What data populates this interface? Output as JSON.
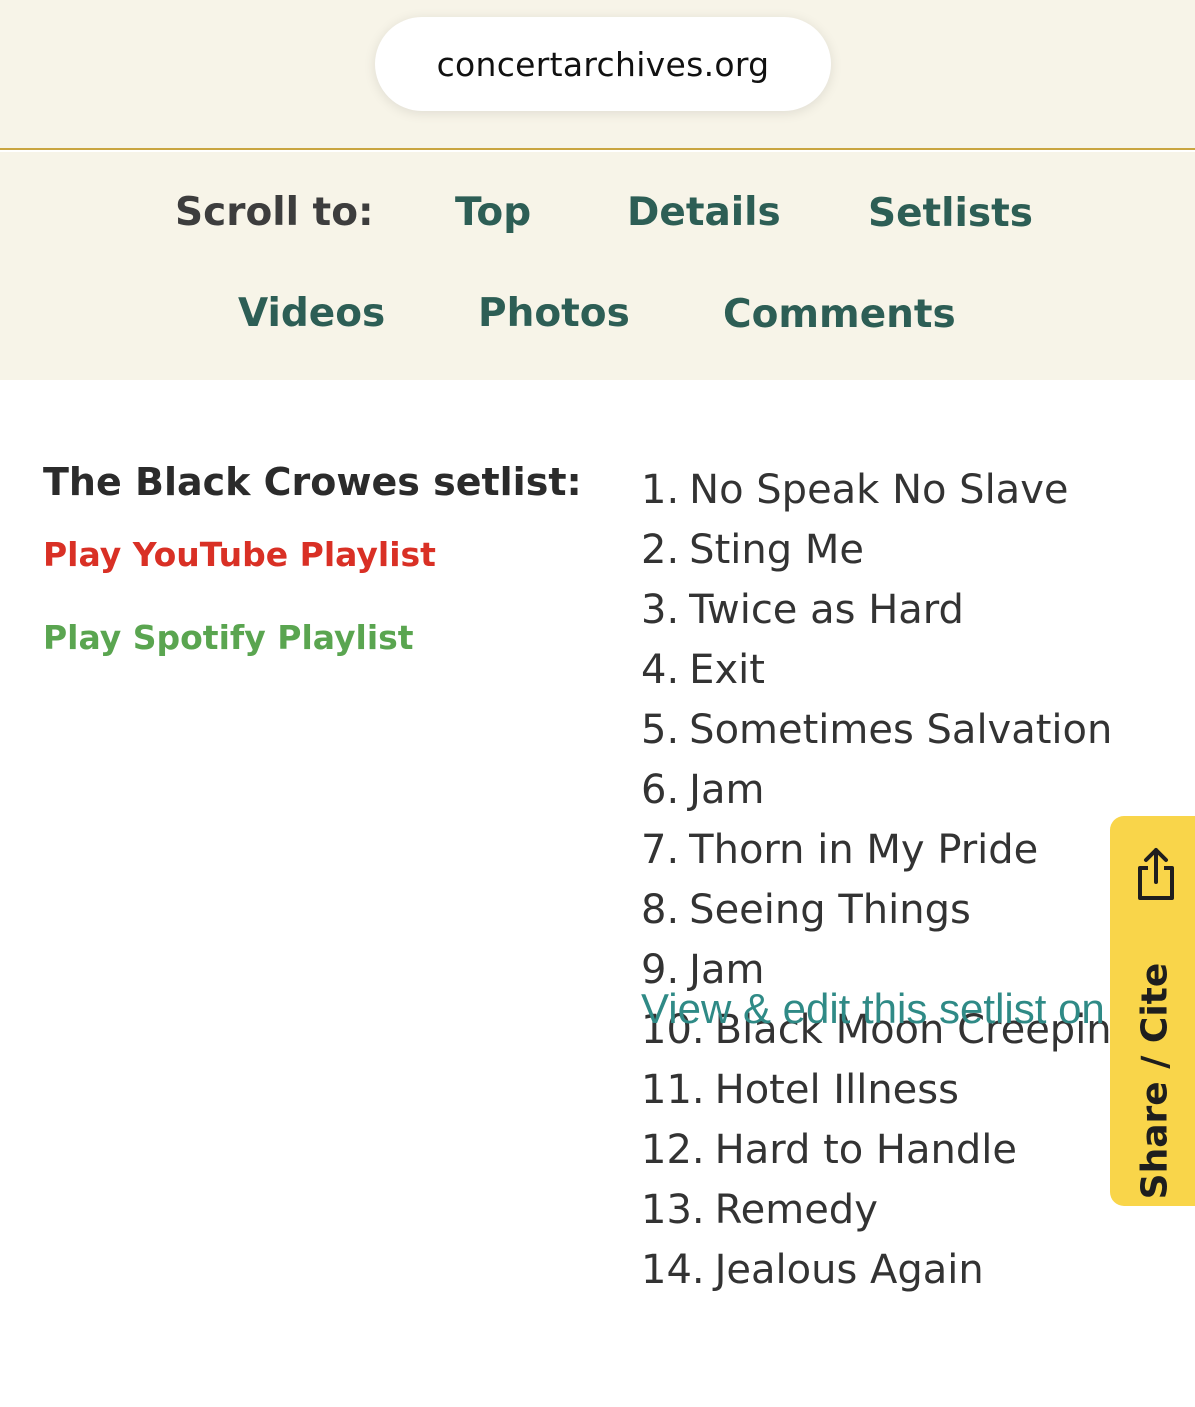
{
  "browser": {
    "url": "concertarchives.org"
  },
  "scroll_nav": {
    "label": "Scroll to:",
    "items": [
      "Top",
      "Details",
      "Setlists",
      "Videos",
      "Photos",
      "Comments"
    ]
  },
  "setlist": {
    "heading": "The Black Crowes setlist:",
    "youtube_link": "Play YouTube Playlist",
    "spotify_link": "Play Spotify Playlist",
    "songs": [
      {
        "num": "1.",
        "title": "No Speak No Slave"
      },
      {
        "num": "2.",
        "title": "Sting Me"
      },
      {
        "num": "3.",
        "title": "Twice as Hard"
      },
      {
        "num": "4.",
        "title": "Exit"
      },
      {
        "num": "5.",
        "title": "Sometimes Salvation"
      },
      {
        "num": "6.",
        "title": "Jam"
      },
      {
        "num": "7.",
        "title": "Thorn in My Pride"
      },
      {
        "num": "8.",
        "title": "Seeing Things"
      },
      {
        "num": "9.",
        "title": "Jam"
      },
      {
        "num": "10.",
        "title": "Black Moon Creeping"
      },
      {
        "num": "11.",
        "title": "Hotel Illness"
      },
      {
        "num": "12.",
        "title": "Hard to Handle"
      },
      {
        "num": "13.",
        "title": "Remedy"
      },
      {
        "num": "14.",
        "title": "Jealous Again"
      }
    ],
    "view_edit_link": "View & edit this setlist on"
  },
  "share_tab": {
    "label": "Share / Cite",
    "icon": "share-icon"
  },
  "colors": {
    "header_bg": "#f7f4e8",
    "nav_link": "#2d5e55",
    "youtube": "#d93025",
    "spotify": "#5aa550",
    "share_tab": "#f9d54a",
    "setlist_link": "#2f8a86"
  }
}
